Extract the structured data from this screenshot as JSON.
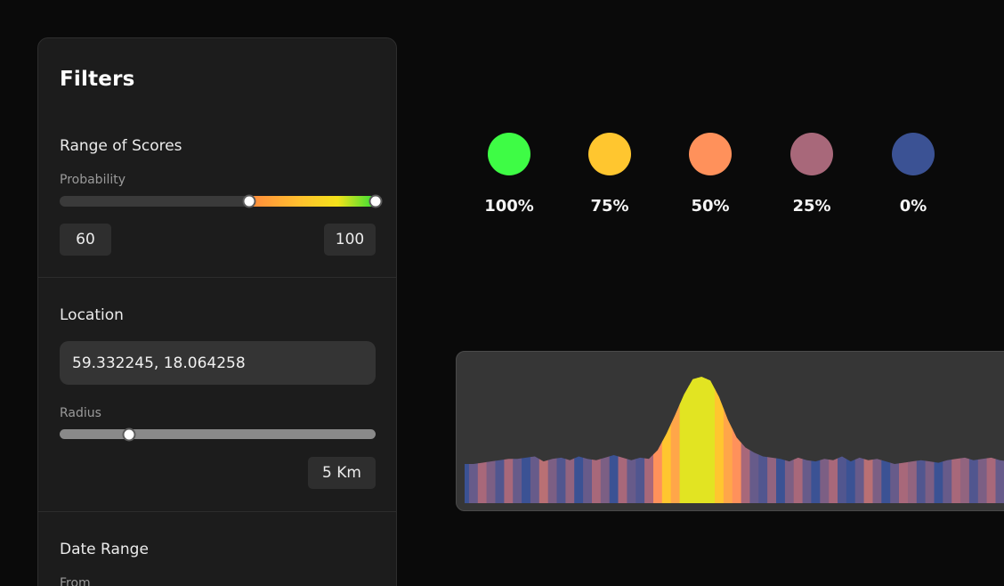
{
  "filters": {
    "title": "Filters",
    "scores": {
      "title": "Range of Scores",
      "sublabel": "Probability",
      "min_value": "60",
      "max_value": "100",
      "range_low": 60,
      "range_high": 100
    },
    "location": {
      "title": "Location",
      "coordinates": "59.332245, 18.064258",
      "radius_label": "Radius",
      "radius_value": "5 Km",
      "radius_fraction": 0.22
    },
    "date_range": {
      "title": "Date Range",
      "from_label": "From"
    }
  },
  "legend": [
    {
      "label": "100%",
      "color": "#3efc45",
      "icon": "green-dot-icon"
    },
    {
      "label": "75%",
      "color": "#ffc62f",
      "icon": "yellow-dot-icon"
    },
    {
      "label": "50%",
      "color": "#ff915b",
      "icon": "orange-dot-icon"
    },
    {
      "label": "25%",
      "color": "#a8687a",
      "icon": "mauve-dot-icon"
    },
    {
      "label": "0%",
      "color": "#3b5294",
      "icon": "blue-dot-icon"
    }
  ],
  "chart_data": {
    "type": "area",
    "title": "",
    "xlabel": "",
    "ylabel": "",
    "grid": false,
    "legend": "none",
    "x": [
      0,
      1,
      2,
      3,
      4,
      5,
      6,
      7,
      8,
      9,
      10,
      11,
      12,
      13,
      14,
      15,
      16,
      17,
      18,
      19,
      20,
      21,
      22,
      23,
      24,
      25,
      26,
      27,
      28,
      29,
      30,
      31,
      32,
      33,
      34,
      35,
      36,
      37,
      38,
      39,
      40,
      41,
      42,
      43,
      44,
      45,
      46,
      47,
      48,
      49,
      50,
      51,
      52,
      53,
      54,
      55,
      56,
      57,
      58,
      59,
      60,
      61,
      62,
      63,
      64
    ],
    "values": [
      0.31,
      0.31,
      0.32,
      0.33,
      0.34,
      0.35,
      0.35,
      0.36,
      0.37,
      0.33,
      0.35,
      0.36,
      0.34,
      0.37,
      0.35,
      0.34,
      0.36,
      0.38,
      0.36,
      0.34,
      0.36,
      0.35,
      0.42,
      0.55,
      0.7,
      0.86,
      0.98,
      1.0,
      0.97,
      0.84,
      0.66,
      0.52,
      0.44,
      0.4,
      0.37,
      0.36,
      0.35,
      0.33,
      0.36,
      0.34,
      0.33,
      0.35,
      0.34,
      0.37,
      0.33,
      0.36,
      0.34,
      0.35,
      0.33,
      0.31,
      0.32,
      0.33,
      0.34,
      0.33,
      0.32,
      0.34,
      0.35,
      0.36,
      0.34,
      0.35,
      0.36,
      0.34,
      0.33,
      0.34,
      0.33
    ],
    "band_scores": [
      0,
      10,
      25,
      15,
      5,
      25,
      10,
      0,
      10,
      30,
      15,
      5,
      20,
      0,
      10,
      25,
      15,
      0,
      25,
      10,
      5,
      25,
      50,
      75,
      60,
      100,
      100,
      100,
      100,
      75,
      60,
      50,
      25,
      10,
      5,
      20,
      0,
      15,
      25,
      10,
      0,
      15,
      25,
      5,
      0,
      10,
      30,
      15,
      0,
      10,
      25,
      20,
      5,
      15,
      0,
      10,
      25,
      20,
      5,
      15,
      25,
      10,
      0,
      20,
      5
    ],
    "ylim": [
      0,
      1
    ]
  }
}
